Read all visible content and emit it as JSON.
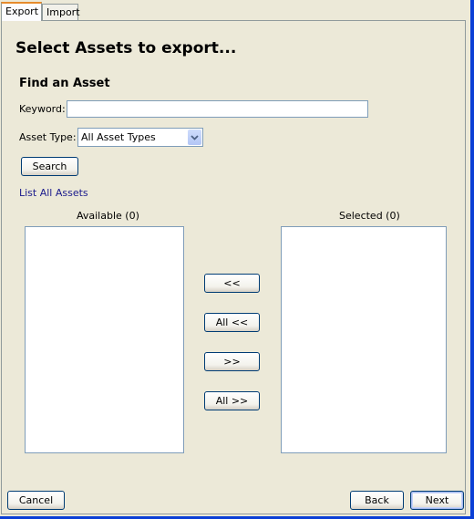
{
  "tabs": [
    {
      "label": "Export",
      "active": true
    },
    {
      "label": "Import",
      "active": false
    }
  ],
  "page_title": "Select Assets to export...",
  "find_section": {
    "heading": "Find an Asset",
    "keyword_label": "Keyword:",
    "keyword_value": "",
    "asset_type_label": "Asset Type:",
    "asset_type_selected": "All Asset Types",
    "search_button": "Search",
    "list_all_link": "List All Assets"
  },
  "available": {
    "label": "Available (0)",
    "items": []
  },
  "selected": {
    "label": "Selected (0)",
    "items": []
  },
  "transfer_buttons": {
    "remove": "<<",
    "remove_all": "All <<",
    "add": ">>",
    "add_all": "All >>"
  },
  "footer": {
    "cancel": "Cancel",
    "back": "Back",
    "next": "Next"
  },
  "colors": {
    "window_frame": "#0a3fd6",
    "panel_bg": "#ece9d8",
    "active_tab_accent": "#e68b2c",
    "link": "#1a1a8c"
  }
}
